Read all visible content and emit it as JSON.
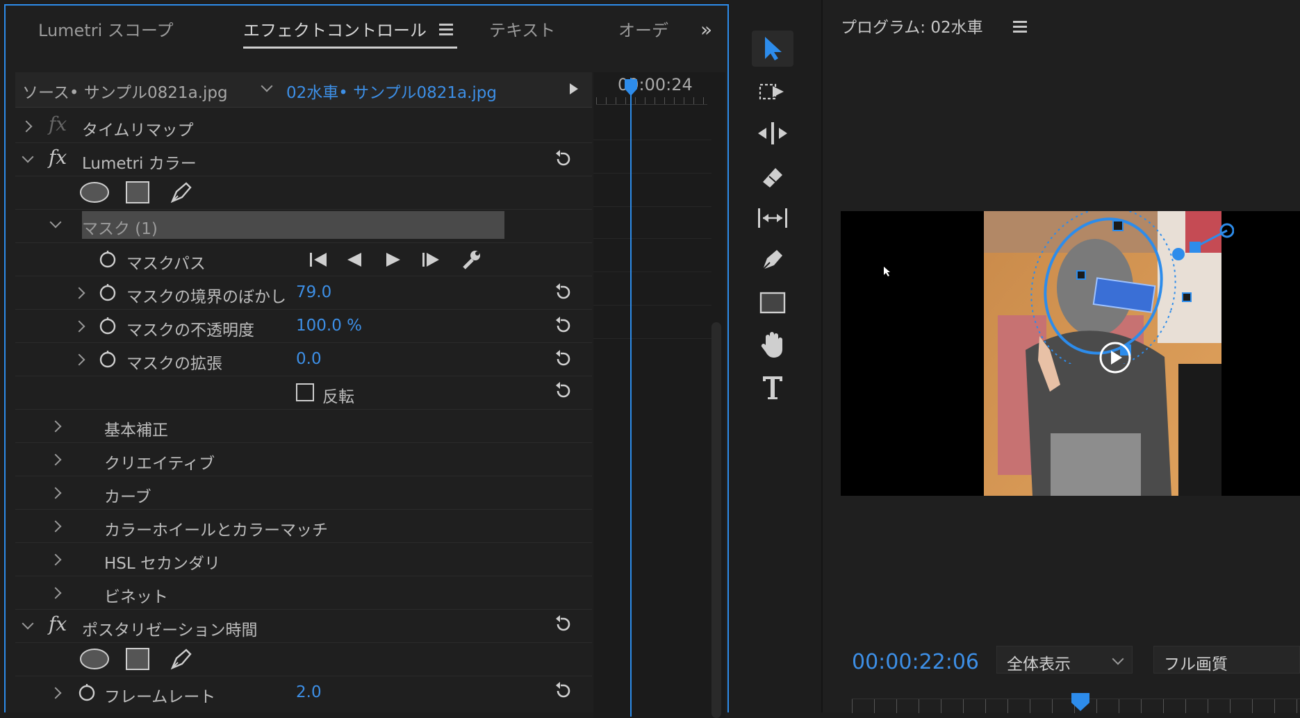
{
  "tabs": [
    {
      "label": "Lumetri スコープ"
    },
    {
      "label": "エフェクトコントロール"
    },
    {
      "label": "テキスト"
    },
    {
      "label": "オーデ"
    }
  ],
  "source_bar": {
    "source_label": "ソース• サンプル0821a.jpg",
    "clip_label": "02水車• サンプル0821a.jpg",
    "timecode": "00:00:24"
  },
  "effects": {
    "time_remap": "タイムリマップ",
    "lumetri_color": "Lumetri カラー",
    "mask_name": "マスク (1)",
    "mask_path": "マスクパス",
    "mask_feather": {
      "label": "マスクの境界のぼかし",
      "value": "79.0"
    },
    "mask_opacity": {
      "label": "マスクの不透明度",
      "value": "100.0 %"
    },
    "mask_expansion": {
      "label": "マスクの拡張",
      "value": "0.0"
    },
    "invert": "反転",
    "sections": [
      "基本補正",
      "クリエイティブ",
      "カーブ",
      "カラーホイールとカラーマッチ",
      "HSL セカンダリ",
      "ビネット"
    ],
    "posterize_time": "ポスタリゼーション時間",
    "frame_rate": {
      "label": "フレームレート",
      "value": "2.0"
    }
  },
  "program": {
    "title": "プログラム: 02水車",
    "timecode": "00:00:22:06",
    "zoom_option": "全体表示",
    "quality_option": "フル画質"
  },
  "colors": {
    "accent": "#2d8ceb",
    "value_blue": "#3d8fe6",
    "panel_bg": "#1f1f1f"
  }
}
